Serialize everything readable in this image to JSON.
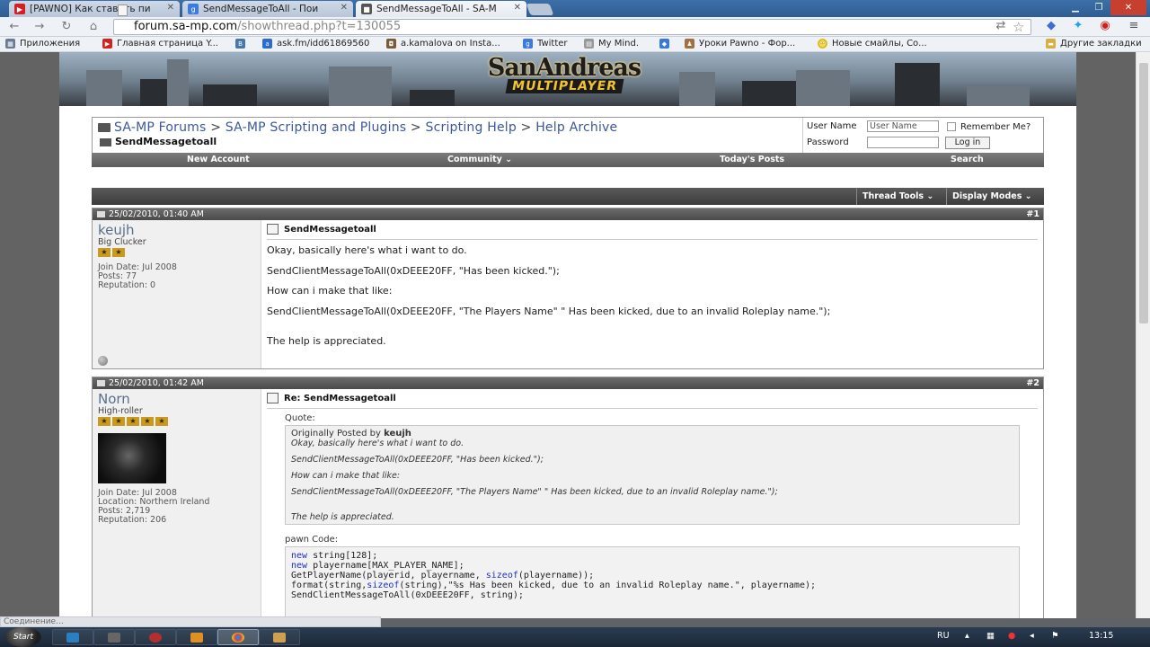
{
  "browser": {
    "tabs": [
      {
        "label": "[PAWNO] Как ставить пи",
        "icon": "youtube-icon"
      },
      {
        "label": "SendMessageToAll - Пои",
        "icon": "google-icon"
      },
      {
        "label": "SendMessageToAll - SA-M",
        "icon": "samp-icon"
      }
    ],
    "url_host": "forum.sa-mp.com",
    "url_path": "/showthread.php?t=130055"
  },
  "bookmarks": [
    {
      "label": "Приложения",
      "icon": "apps-icon"
    },
    {
      "label": "Главная страница Y...",
      "icon": "youtube-icon"
    },
    {
      "label": "",
      "icon": "vk-icon"
    },
    {
      "label": "ask.fm/idd61869560",
      "icon": "askfm-icon"
    },
    {
      "label": "a.kamalova on Insta...",
      "icon": "instagram-icon"
    },
    {
      "label": "Twitter",
      "icon": "google-icon"
    },
    {
      "label": "My Mind.",
      "icon": "page-icon"
    },
    {
      "label": "",
      "icon": "bookmark-icon"
    },
    {
      "label": "Уроки Pawno - Фор...",
      "icon": "pawno-icon"
    },
    {
      "label": "Новые смайлы, Со...",
      "icon": "smiley-icon"
    },
    {
      "label": "Другие закладки",
      "icon": "folder-icon"
    }
  ],
  "forum": {
    "logo_line1": "SanAndreas",
    "logo_line2": "MULTIPLAYER",
    "breadcrumbs": [
      "SA-MP Forums",
      "SA-MP Scripting and Plugins",
      "Scripting Help",
      "Help Archive"
    ],
    "breadcrumb_sep": ">",
    "thread_title": "SendMessagetoall",
    "login": {
      "username_label": "User Name",
      "username_placeholder": "User Name",
      "password_label": "Password",
      "remember_label": "Remember Me?",
      "login_button": "Log in"
    },
    "menu": [
      "New Account",
      "Community ⌄",
      "Today's Posts",
      "Search"
    ],
    "thread_tools": "Thread Tools ⌄",
    "display_modes": "Display Modes ⌄"
  },
  "posts": [
    {
      "date": "25/02/2010, 01:40 AM",
      "number": "#1",
      "username": "keujh",
      "user_title": "Big Clucker",
      "stars": 2,
      "info": [
        "Join Date: Jul 2008",
        "Posts: 77",
        "Reputation: 0"
      ],
      "title": "SendMessagetoall",
      "lines": [
        "Okay, basically here's what i want to do.",
        "SendClientMessageToAll(0xDEEE20FF, \"Has been kicked.\");",
        "How can i make that like:",
        "SendClientMessageToAll(0xDEEE20FF, \"The Players Name\" \" Has been kicked, due to an invalid Roleplay name.\");",
        "The help is appreciated."
      ]
    },
    {
      "date": "25/02/2010, 01:42 AM",
      "number": "#2",
      "username": "Norn",
      "user_title": "High-roller",
      "stars": 5,
      "info": [
        "Join Date: Jul 2008",
        "Location: Northern Ireland",
        "Posts: 2,719",
        "Reputation: 206"
      ],
      "title": "Re: SendMessagetoall",
      "quote_label": "Quote:",
      "quote_by_prefix": "Originally Posted by",
      "quote_author": "keujh",
      "quote_lines": [
        "Okay, basically here's what i want to do.",
        "SendClientMessageToAll(0xDEEE20FF, \"Has been kicked.\");",
        "How can i make that like:",
        "SendClientMessageToAll(0xDEEE20FF, \"The Players Name\" \" Has been kicked, due to an invalid Roleplay name.\");",
        "The help is appreciated."
      ],
      "code_label": "pawn Code:",
      "code": {
        "l1_kw": "new",
        "l1": " string[128];",
        "l2_kw": "new",
        "l2": " playername[MAX_PLAYER_NAME];",
        "l3a": "GetPlayerName(playerid, playername, ",
        "l3_kw": "sizeof",
        "l3b": "(playername));",
        "l4a": "format(string,",
        "l4_kw": "sizeof",
        "l4b": "(string),\"%s Has been kicked, due to an invalid Roleplay name.\", playername);",
        "l5": "SendClientMessageToAll(0xDEEE20FF, string);"
      }
    }
  ],
  "status_text": "Соединение...",
  "taskbar": {
    "start": "Start",
    "lang": "RU",
    "clock": "13:15"
  }
}
